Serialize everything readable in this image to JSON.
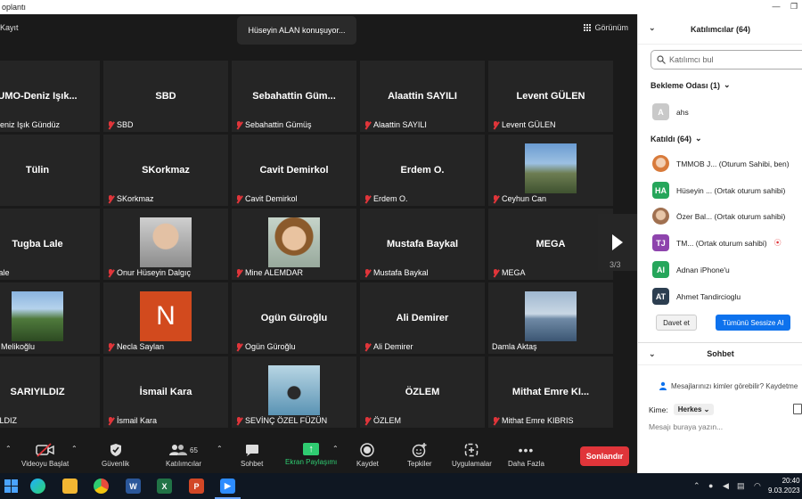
{
  "window": {
    "title": "oplantı"
  },
  "topbar": {
    "record_label": "Kayıt",
    "speaker": "Hüseyin ALAN konuşuyor...",
    "view_label": "Görünüm"
  },
  "tiles": [
    {
      "name": "UMO-Deniz  Işık...",
      "label": "MO-Deniz Işık Gündüz",
      "muted": false,
      "photo": ""
    },
    {
      "name": "SBD",
      "label": "SBD",
      "muted": true,
      "photo": ""
    },
    {
      "name": "Sebahattin  Güm...",
      "label": "Sebahattin Gümüş",
      "muted": true,
      "photo": ""
    },
    {
      "name": "Alaattin SAYILI",
      "label": "Alaattin SAYILI",
      "muted": true,
      "photo": ""
    },
    {
      "name": "Levent GÜLEN",
      "label": "Levent GÜLEN",
      "muted": true,
      "photo": ""
    },
    {
      "name": "Tülin",
      "label": "lin",
      "muted": false,
      "photo": ""
    },
    {
      "name": "SKorkmaz",
      "label": "SKorkmaz",
      "muted": true,
      "photo": ""
    },
    {
      "name": "Cavit Demirkol",
      "label": "Cavit Demirkol",
      "muted": true,
      "photo": ""
    },
    {
      "name": "Erdem O.",
      "label": "Erdem O.",
      "muted": true,
      "photo": ""
    },
    {
      "name": "",
      "label": "Ceyhun Can",
      "muted": true,
      "photo": "landscape"
    },
    {
      "name": "Tugba Lale",
      "label": "gba Lale",
      "muted": false,
      "photo": ""
    },
    {
      "name": "",
      "label": "Onur Hüseyin Dalgıç",
      "muted": true,
      "photo": "face"
    },
    {
      "name": "",
      "label": "Mine ALEMDAR",
      "muted": true,
      "photo": "woman"
    },
    {
      "name": "Mustafa Baykal",
      "label": "Mustafa Baykal",
      "muted": true,
      "photo": ""
    },
    {
      "name": "MEGA",
      "label": "MEGA",
      "muted": true,
      "photo": ""
    },
    {
      "name": "",
      "label": "şenur Melikoğlu",
      "muted": false,
      "photo": "park"
    },
    {
      "name": "",
      "label": "Necla Saylan",
      "muted": true,
      "photo": "n",
      "initial": "N"
    },
    {
      "name": "Ogün Güroğlu",
      "label": "Ogün Güroğlu",
      "muted": true,
      "photo": ""
    },
    {
      "name": "Ali Demirer",
      "label": "Ali Demirer",
      "muted": true,
      "photo": ""
    },
    {
      "name": "",
      "label": "Damla Aktaş",
      "muted": false,
      "photo": "sea"
    },
    {
      "name": "SARIYILDIZ",
      "label": "ARIYILDIZ",
      "muted": false,
      "photo": ""
    },
    {
      "name": "İsmail Kara",
      "label": "İsmail Kara",
      "muted": true,
      "photo": ""
    },
    {
      "name": "",
      "label": "SEVİNÇ ÖZEL FÜZÜN",
      "muted": true,
      "photo": "water"
    },
    {
      "name": "ÖZLEM",
      "label": "ÖZLEM",
      "muted": true,
      "photo": ""
    },
    {
      "name": "Mithat  Emre KI...",
      "label": "Mithat  Emre KIBRIS",
      "muted": true,
      "photo": ""
    }
  ],
  "pager": {
    "text": "3/3"
  },
  "toolbar": {
    "video": "Videoyu Başlat",
    "security": "Güvenlik",
    "participants": "Katılımcılar",
    "participants_count": "65",
    "chat": "Sohbet",
    "share": "Ekran Paylaşımı",
    "record": "Kaydet",
    "reactions": "Tepkiler",
    "apps": "Uygulamalar",
    "more": "Daha Fazla",
    "end": "Sonlandır"
  },
  "panel": {
    "title": "Katılımcılar (64)",
    "search_placeholder": "Katılımcı bul",
    "waiting_title": "Bekleme Odası  (1)",
    "waiting": [
      {
        "initial": "A",
        "name": "ahs",
        "color": "#c9c9c9"
      }
    ],
    "joined_title": "Katıldı  (64)",
    "joined": [
      {
        "initial": "",
        "name": "TMMOB J...  (Oturum Sahibi, ben)",
        "color": "#d87a3a"
      },
      {
        "initial": "HA",
        "name": "Hüseyin ...   (Ortak oturum sahibi)",
        "color": "#26a65b"
      },
      {
        "initial": "",
        "name": "Özer Bal...   (Ortak oturum sahibi)",
        "color": "#a07050"
      },
      {
        "initial": "TJ",
        "name": "TM...      (Ortak oturum sahibi)",
        "color": "#8e44ad"
      },
      {
        "initial": "AI",
        "name": "Adnan iPhone'u",
        "color": "#26a65b"
      },
      {
        "initial": "AT",
        "name": "Ahmet Tandircioglu",
        "color": "#2c3e50"
      }
    ],
    "invite": "Davet et",
    "mute_all": "Tümünü Sessize Al"
  },
  "chat": {
    "title": "Sohbet",
    "privacy": "Mesajlarınızı kimler görebilir? Kaydetme",
    "to_label": "Kime:",
    "to_value": "Herkes",
    "placeholder": "Mesajı buraya yazın..."
  },
  "taskbar": {
    "time": "20:40",
    "date": "9.03.2023"
  },
  "colors": {
    "accent": "#0e72ed",
    "end": "#e0353a",
    "share": "#2fcc71"
  }
}
